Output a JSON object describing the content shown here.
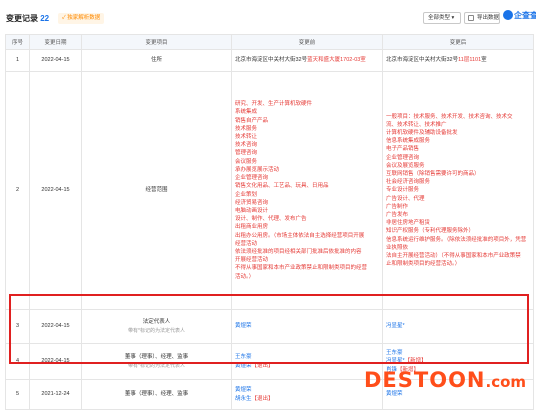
{
  "header": {
    "title": "变更记录",
    "count": "22",
    "badge": "✓ 独家解析数据",
    "filter_label": "全部类型 ▾",
    "export_label": "导出数据",
    "logo_text": "企查查"
  },
  "table": {
    "columns": [
      "序号",
      "变更日期",
      "变更项目",
      "变更前",
      "变更后"
    ],
    "rows": [
      {
        "no": "1",
        "date": "2022-04-15",
        "item": "住所",
        "before": {
          "pre": "北京市海淀区中关村大街32号",
          "red": "蓝天和盛大厦1702-03室",
          "post": ""
        },
        "after": {
          "pre": "北京市海淀区中关村大街32号",
          "red": "11层1101",
          "post": "室"
        }
      },
      {
        "no": "2",
        "date": "2022-04-15",
        "item": "经营范围",
        "before_lines": [
          "研究、开发、生产计算机软硬件",
          "系统集成",
          "销售自产产品",
          "技术服务",
          "技术转让",
          "技术咨询",
          "管理咨询",
          "会议服务",
          "承办展览展示活动",
          "企业管理咨询",
          "销售文化用品、工艺品、玩具、日用品",
          "企业策划",
          "经济贸易咨询",
          "电脑动画设计",
          "设计、制作、代理、发布广告",
          "出租商业用房",
          "出租办公用房。（市场主体依法自主选择经营项目开展",
          "经营活动",
          "依法须经批准的项目经相关部门批准后依批准的内容",
          "开展经营活动",
          "不得从事国家和本市产业政策禁止和限制类项目的经营",
          "活动。）"
        ],
        "after_lines": [
          "一般项目：技术服务、技术开发、技术咨询、技术交",
          "流、技术转让、技术推广",
          "计算机软硬件及辅助设备批发",
          "信息系统集成服务",
          "电子产品销售",
          "企业管理咨询",
          "会议及展览服务",
          "互联网销售（除销售需要许可的商品）",
          "社会经济咨询服务",
          "专业设计服务",
          "广告设计、代理",
          "广告制作",
          "广告发布",
          "非居住房地产租赁",
          "知识产权服务（专利代理服务除外）",
          "信息系统运行维护服务。（除依法须经批准的项目外，凭营业执照依",
          "法自主开展经营活动）（不得从事国家和本市产业政策禁",
          "止和限制类项目的经营活动。）"
        ]
      },
      {
        "no": "3",
        "date": "2022-04-15",
        "item": "法定代表人",
        "item_sub": "带有*标记的为法定代表人",
        "before": {
          "name": "黄煜荣"
        },
        "after": {
          "name": "冯显星*"
        }
      },
      {
        "no": "4",
        "date": "2022-04-15",
        "item": "董事（理事）、经理、监事",
        "item_sub": "带有*标记的为法定代表人",
        "before_names": [
          {
            "name": "王东豪",
            "tag": ""
          },
          {
            "name": "黄煜荣",
            "tag": "【退出】"
          }
        ],
        "after_names": [
          {
            "name": "王东豪",
            "tag": ""
          },
          {
            "name": "冯显星*",
            "tag": "【新增】"
          },
          {
            "name": "肖锋",
            "tag": "【新增】"
          }
        ]
      },
      {
        "no": "5",
        "date": "2021-12-24",
        "item": "董事（理事）、经理、监事",
        "before_names": [
          {
            "name": "黄煜荣",
            "tag": ""
          },
          {
            "name": "胡永生",
            "tag": "【退出】"
          }
        ],
        "after_names": [
          {
            "name": "黄煜荣",
            "tag": ""
          }
        ]
      }
    ]
  },
  "watermark": {
    "main": "DESTOON",
    "suffix": ".com"
  }
}
